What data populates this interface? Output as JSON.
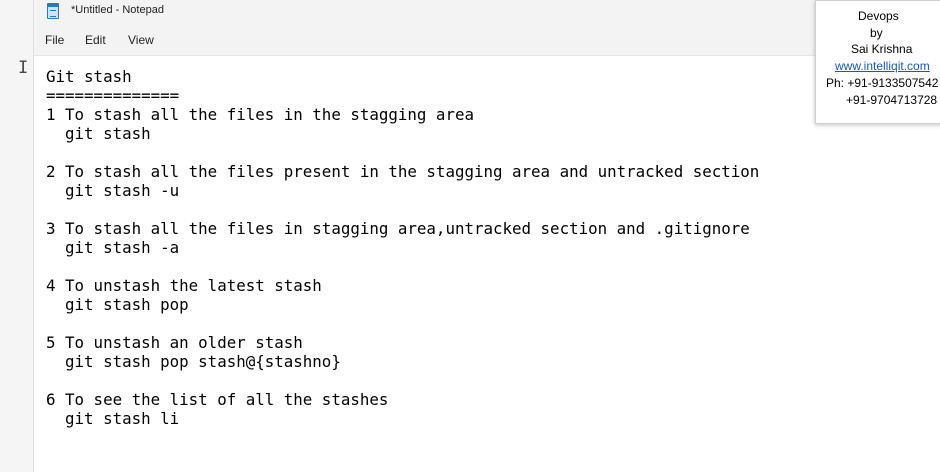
{
  "window": {
    "title": "*Untitled - Notepad",
    "icon": "notepad-icon"
  },
  "menu": {
    "file": "File",
    "edit": "Edit",
    "view": "View"
  },
  "editor": {
    "text": "Git stash\n==============\n1 To stash all the files in the stagging area\n  git stash\n\n2 To stash all the files present in the stagging area and untracked section\n  git stash -u\n\n3 To stash all the files in stagging area,untracked section and .gitignore\n  git stash -a\n\n4 To unstash the latest stash\n  git stash pop\n\n5 To unstash an older stash\n  git stash pop stash@{stashno}\n\n6 To see the list of all the stashes\n  git stash li"
  },
  "cursor": {
    "glyph": "I"
  },
  "promo": {
    "course": "Devops",
    "by": "by",
    "trainer": "Sai Krishna",
    "website": "www.intelliqit.com",
    "phone1": "Ph: +91-9133507542",
    "phone2": "+91-9704713728"
  },
  "colors": {
    "link": "#1a56c9",
    "chrome": "#f3f3f3",
    "text": "#000000"
  }
}
